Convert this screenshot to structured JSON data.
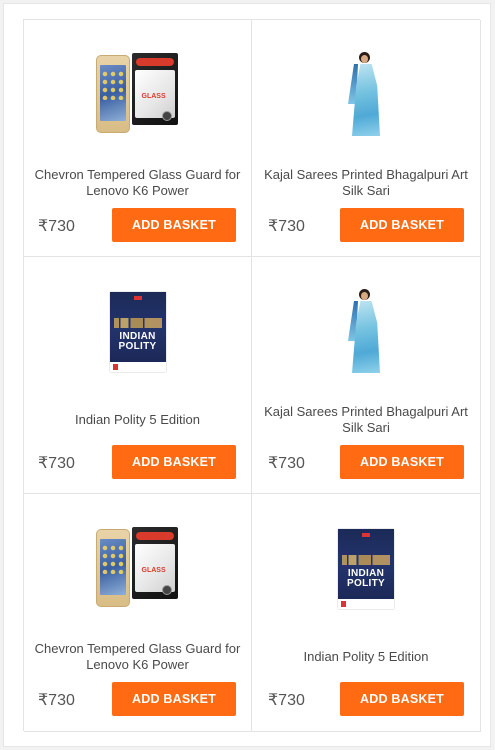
{
  "products": [
    {
      "title": "Chevron Tempered Glass Guard for Lenovo K6 Power",
      "price": "₹730",
      "button": "ADD BASKET",
      "image": "phone-screen-guard",
      "book_line1": "",
      "book_line2": ""
    },
    {
      "title": "Kajal Sarees Printed Bhagalpuri Art Silk Sari",
      "price": "₹730",
      "button": "ADD BASKET",
      "image": "saree",
      "book_line1": "",
      "book_line2": ""
    },
    {
      "title": "Indian Polity 5 Edition",
      "price": "₹730",
      "button": "ADD BASKET",
      "image": "book",
      "book_line1": "INDIAN",
      "book_line2": "POLITY"
    },
    {
      "title": "Kajal Sarees Printed Bhagalpuri Art Silk Sari",
      "price": "₹730",
      "button": "ADD BASKET",
      "image": "saree",
      "book_line1": "",
      "book_line2": ""
    },
    {
      "title": "Chevron Tempered Glass Guard for Lenovo K6 Power",
      "price": "₹730",
      "button": "ADD BASKET",
      "image": "phone-screen-guard",
      "book_line1": "",
      "book_line2": ""
    },
    {
      "title": "Indian Polity 5 Edition",
      "price": "₹730",
      "button": "ADD BASKET",
      "image": "book",
      "book_line1": "INDIAN",
      "book_line2": "POLITY"
    }
  ],
  "colors": {
    "accent": "#ff6a13",
    "text": "#4a4a4a",
    "border": "#e3e3e3"
  }
}
